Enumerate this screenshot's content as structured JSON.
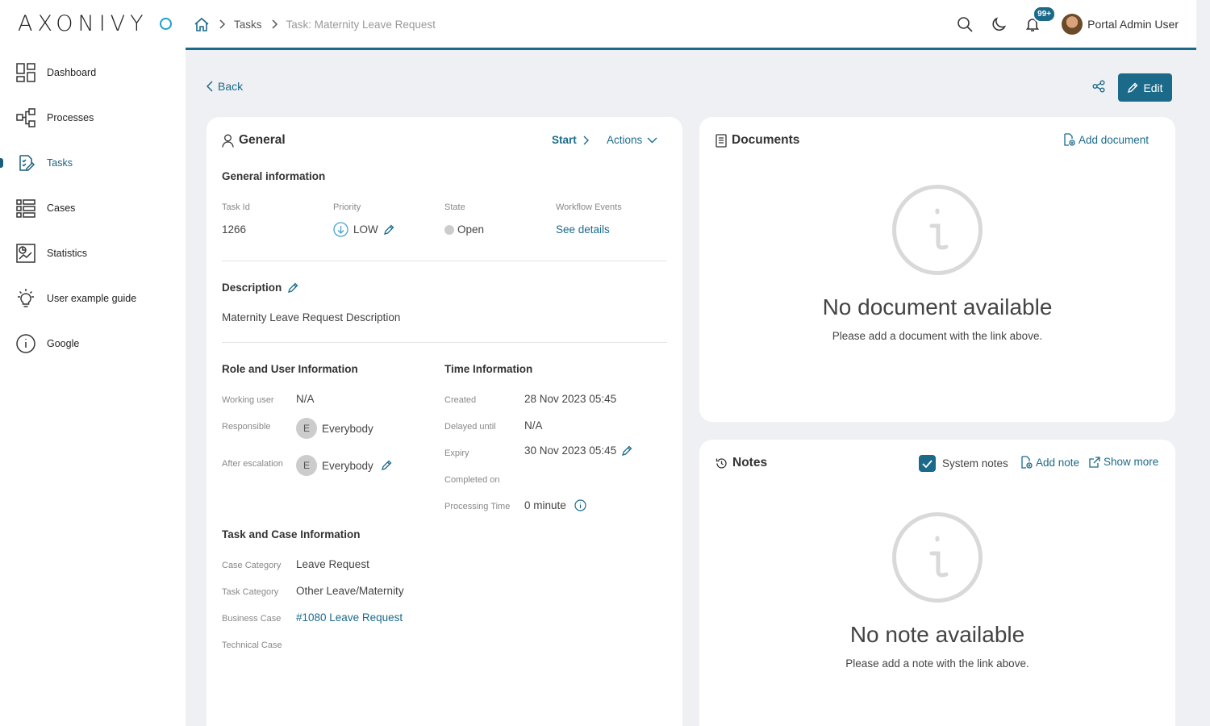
{
  "app": {
    "logo_text": "AXONIVY"
  },
  "sidebar": {
    "items": [
      {
        "label": "Dashboard",
        "icon": "dashboard-icon"
      },
      {
        "label": "Processes",
        "icon": "processes-icon"
      },
      {
        "label": "Tasks",
        "icon": "tasks-icon",
        "active": true
      },
      {
        "label": "Cases",
        "icon": "cases-icon"
      },
      {
        "label": "Statistics",
        "icon": "statistics-icon"
      },
      {
        "label": "User example guide",
        "icon": "lightbulb-icon"
      },
      {
        "label": "Google",
        "icon": "info-icon"
      }
    ]
  },
  "header": {
    "breadcrumb": {
      "tasks": "Tasks",
      "current": "Task: Maternity Leave Request"
    },
    "notification_badge": "99+",
    "username": "Portal Admin User"
  },
  "page": {
    "back_label": "Back",
    "edit_label": "Edit"
  },
  "general": {
    "title": "General",
    "start_label": "Start",
    "actions_label": "Actions",
    "info_heading": "General information",
    "task_id_label": "Task Id",
    "task_id": "1266",
    "priority_label": "Priority",
    "priority": "LOW",
    "state_label": "State",
    "state": "Open",
    "workflow_label": "Workflow Events",
    "workflow_link": "See details",
    "description_heading": "Description",
    "description": "Maternity Leave Request Description",
    "role_heading": "Role and User Information",
    "working_user_label": "Working user",
    "working_user": "N/A",
    "responsible_label": "Responsible",
    "responsible": "Everybody",
    "responsible_initial": "E",
    "after_escalation_label": "After escalation",
    "after_escalation": "Everybody",
    "after_escalation_initial": "E",
    "time_heading": "Time Information",
    "created_label": "Created",
    "created": "28 Nov 2023 05:45",
    "delayed_label": "Delayed until",
    "delayed": "N/A",
    "expiry_label": "Expiry",
    "expiry": "30 Nov 2023 05:45",
    "completed_label": "Completed on",
    "processing_label": "Processing Time",
    "processing": "0 minute",
    "taskcase_heading": "Task and Case Information",
    "case_category_label": "Case Category",
    "case_category": "Leave Request",
    "task_category_label": "Task Category",
    "task_category": "Other Leave/Maternity",
    "business_case_label": "Business Case",
    "business_case": "#1080 Leave Request",
    "technical_case_label": "Technical Case"
  },
  "documents": {
    "title": "Documents",
    "add_label": "Add document",
    "empty_title": "No document available",
    "empty_sub": "Please add a document with the link above."
  },
  "notes": {
    "title": "Notes",
    "system_notes_label": "System notes",
    "system_notes_checked": true,
    "add_label": "Add note",
    "show_more_label": "Show more",
    "empty_title": "No note available",
    "empty_sub": "Please add a note with the link above."
  },
  "colors": {
    "accent": "#1b6a8a",
    "logo_dot": "#1ea0c8"
  }
}
